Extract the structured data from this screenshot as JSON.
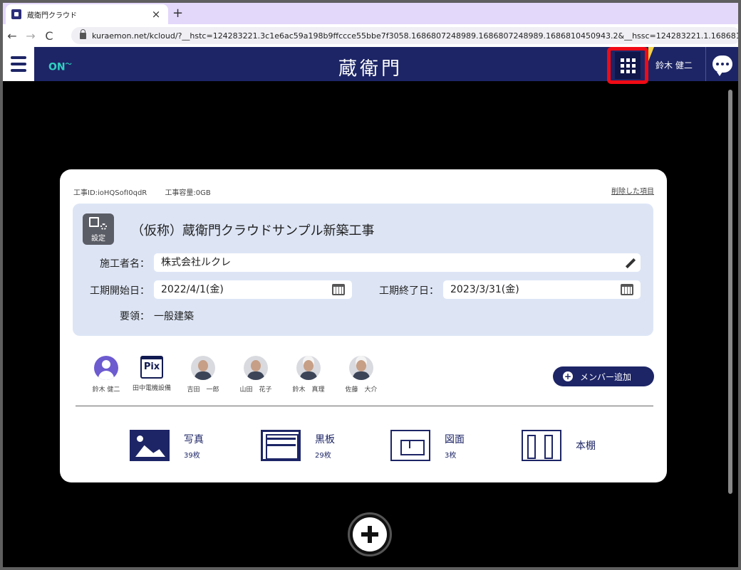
{
  "browser": {
    "tab_title": "蔵衛門クラウド",
    "tab_close": "×",
    "new_tab": "+",
    "back": "←",
    "forward": "→",
    "reload": "C",
    "url": "kuraemon.net/kcloud/?__hstc=124283221.3c1e6ac59a198b9ffccce55bbe7f3058.1686807248989.1686807248989.1686810450943.2&__hssc=124283221.1.168681"
  },
  "appbar": {
    "online_status": "ON",
    "logo": "蔵衛門",
    "user_name": "鈴木 健二"
  },
  "project": {
    "id_label": "工事ID:ioHQSofI0qdR",
    "capacity_label": "工事容量:0GB",
    "deleted_items_link": "削除した項目",
    "settings_label": "設定",
    "name": "（仮称）蔵衛門クラウドサンプル新築工事",
    "contractor_label": "施工者名：",
    "contractor_value": "株式会社ルクレ",
    "start_label": "工期開始日：",
    "start_value": "2022/4/1(金)",
    "end_label": "工期終了日：",
    "end_value": "2023/3/31(金)",
    "summary_label": "要領：",
    "summary_value": "一般建築"
  },
  "members": [
    {
      "name": "鈴木 健二",
      "avatar": "user-icon"
    },
    {
      "name": "田中電機設備",
      "avatar": "pix-logo"
    },
    {
      "name": "吉田　一郎",
      "avatar": "photo"
    },
    {
      "name": "山田　花子",
      "avatar": "photo"
    },
    {
      "name": "鈴木　真理",
      "avatar": "photo-helmet"
    },
    {
      "name": "佐藤　大介",
      "avatar": "photo-helmet"
    }
  ],
  "pix_label": "Pix",
  "add_member_label": "メンバー追加",
  "categories": [
    {
      "label": "写真",
      "count": "39枚",
      "icon": "photo-icon"
    },
    {
      "label": "黒板",
      "count": "29枚",
      "icon": "blackboard-icon"
    },
    {
      "label": "図面",
      "count": "3枚",
      "icon": "floorplan-icon"
    },
    {
      "label": "本棚",
      "count": "",
      "icon": "bookshelf-icon"
    }
  ],
  "colors": {
    "header": "#1d2566",
    "highlight_box": "#f00a15",
    "online": "#2fd2c0",
    "panel": "#dde5f5"
  }
}
